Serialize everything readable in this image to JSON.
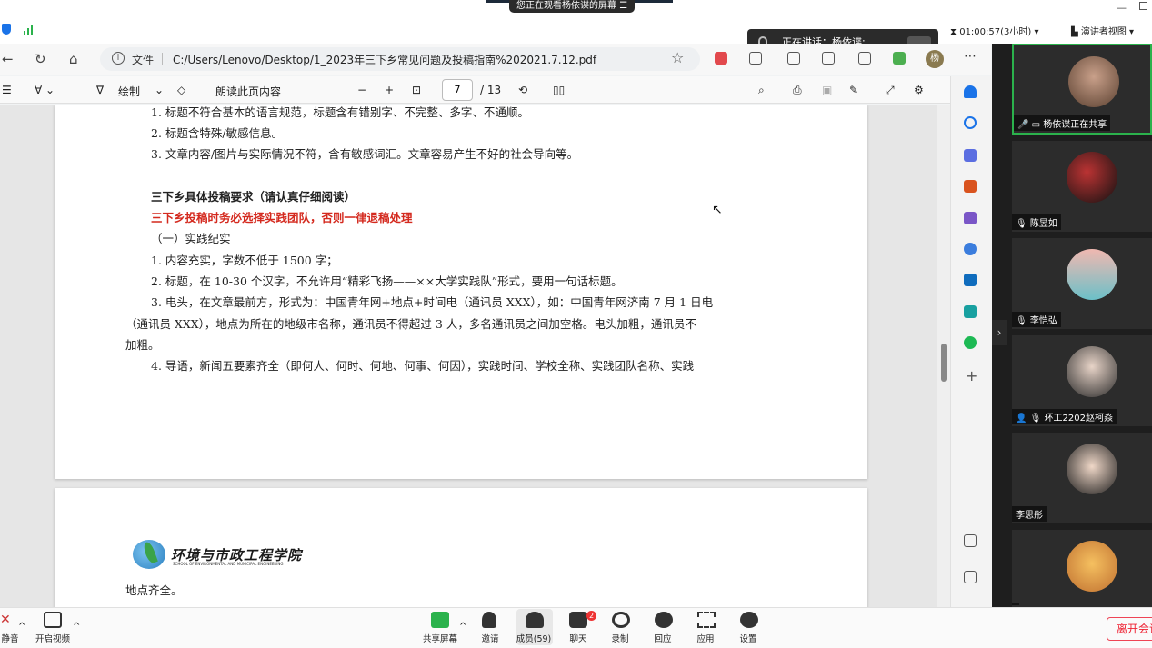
{
  "system": {
    "share_banner": "您正在观看杨依谍的屏幕",
    "speaking_label": "正在讲话：杨依谍;",
    "timer": "01:00:57(3小时)",
    "presenter_view": "演讲者视图"
  },
  "browser": {
    "file_label": "文件",
    "url": "C:/Users/Lenovo/Desktop/1_2023年三下乡常见问题及投稿指南%202021.7.12.pdf",
    "avatar_letter": "杨"
  },
  "pdf_toolbar": {
    "draw_label": "绘制",
    "read_aloud_label": "朗读此页内容",
    "page_current": "7",
    "page_total": "/ 13"
  },
  "document": {
    "page1_lines": [
      "1. 标题不符合基本的语言规范，标题含有错别字、不完整、多字、不通顺。",
      "2. 标题含特殊/敏感信息。",
      "3. 文章内容/图片与实际情况不符，含有敏感词汇。文章容易产生不好的社会导向等。",
      "三下乡具体投稿要求（请认真仔细阅读）",
      "三下乡投稿时务必选择实践团队，否则一律退稿处理",
      "（一）实践纪实",
      "1. 内容充实，字数不低于 1500 字；",
      "2. 标题，在 10-30 个汉字，不允许用“精彩飞扬——××大学实践队”形式，要用一句话标题。",
      "3. 电头，在文章最前方，形式为：中国青年网+地点+时间电（通讯员 XXX），如：中国青年网济南 7 月 1 日电",
      "（通讯员 XXX），地点为所在的地级市名称，通讯员不得超过 3 人，多名通讯员之间加空格。电头加粗，通讯员不",
      "加粗。",
      "4. 导语，新闻五要素齐全（即何人、何时、何地、何事、何因），实践时间、学校全称、实践团队名称、实践"
    ],
    "logo_text": "环境与市政工程学院",
    "logo_sub": "SCHOOL OF ENVIRONMENTAL AND MUNICIPAL ENGINEERING",
    "page2_line": "地点齐全。"
  },
  "participants": [
    {
      "name": "杨依谍正在共享"
    },
    {
      "name": "陈昱如"
    },
    {
      "name": "李恺弘"
    },
    {
      "name": "环工2202赵柯焱"
    },
    {
      "name": "李思彤"
    },
    {
      "name": ""
    }
  ],
  "bottom_bar": {
    "mute": "静音",
    "video": "开启视频",
    "share": "共享屏幕",
    "invite": "邀请",
    "members": "成员(59)",
    "chat": "聊天",
    "chat_badge": "2",
    "record": "录制",
    "reactions": "回应",
    "apps": "应用",
    "settings": "设置",
    "leave": "离开会议"
  }
}
